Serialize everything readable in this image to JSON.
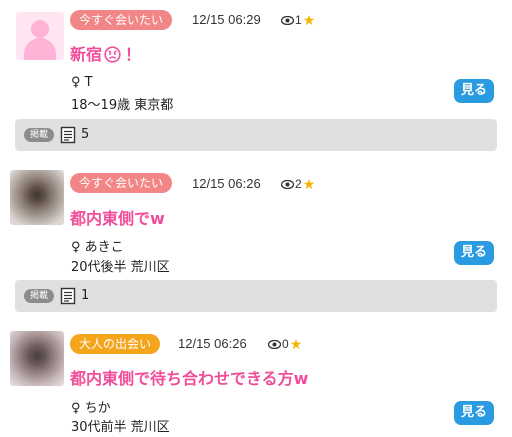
{
  "posts": [
    {
      "tag": "今すぐ会いたい",
      "tag_color": "#f28686",
      "time": "12/15 06:29",
      "views": "1",
      "title": "新宿",
      "title_suffix": "！",
      "gender": "♀ T",
      "info": "18～19歳 東京都",
      "button": "見る",
      "badge": "掲載",
      "count": "5"
    },
    {
      "tag": "今すぐ会いたい",
      "tag_color": "#f28686",
      "time": "12/15 06:26",
      "views": "2",
      "title": "都内東側でw",
      "gender": "♀ あきこ",
      "info": "20代後半 荒川区",
      "button": "見る",
      "badge": "掲載",
      "count": "1"
    },
    {
      "tag": "大人の出会い",
      "tag_color": "#f5a51c",
      "time": "12/15 06:26",
      "views": "0",
      "title": "都内東側で待ち合わせできる方w",
      "gender": "♀ ちか",
      "info": "30代前半 荒川区",
      "button": "見る"
    }
  ],
  "colors": {
    "title": "#f24d9a",
    "button": "#2a9be0",
    "star": "#f6b400"
  },
  "icons": [
    "eye-icon",
    "star-icon",
    "document-icon",
    "angry-face-emoji",
    "female-symbol"
  ]
}
